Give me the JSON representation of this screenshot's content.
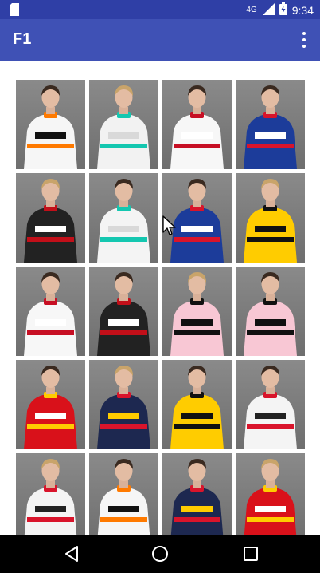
{
  "status_bar": {
    "network": "4G",
    "time": "9:34",
    "icons": [
      "sd-card-icon",
      "signal-icon",
      "battery-icon"
    ]
  },
  "app_bar": {
    "title": "F1",
    "menu_icon": "overflow-menu-icon"
  },
  "grid": {
    "tiles": [
      {
        "suit": "#f6f6f6",
        "accent": "#ff7a00",
        "stripe": "#111111",
        "name": "driver-photo-1"
      },
      {
        "suit": "#f2f2f2",
        "accent": "#14c7b0",
        "stripe": "#d9d9d9",
        "name": "driver-photo-2"
      },
      {
        "suit": "#f7f7f7",
        "accent": "#c70f24",
        "stripe": "#ffffff",
        "name": "driver-photo-3"
      },
      {
        "suit": "#1c3c9a",
        "accent": "#d9142b",
        "stripe": "#ffffff",
        "name": "driver-photo-4"
      },
      {
        "suit": "#222222",
        "accent": "#c20f19",
        "stripe": "#ffffff",
        "name": "driver-photo-5"
      },
      {
        "suit": "#f4f4f4",
        "accent": "#14c7b0",
        "stripe": "#d9d9d9",
        "name": "driver-photo-6"
      },
      {
        "suit": "#1c3c9a",
        "accent": "#d9142b",
        "stripe": "#ffffff",
        "name": "driver-photo-7"
      },
      {
        "suit": "#ffcc00",
        "accent": "#111111",
        "stripe": "#111111",
        "name": "driver-photo-8"
      },
      {
        "suit": "#f7f7f7",
        "accent": "#c70f24",
        "stripe": "#ffffff",
        "name": "driver-photo-9"
      },
      {
        "suit": "#222222",
        "accent": "#c20f19",
        "stripe": "#ffffff",
        "name": "driver-photo-10"
      },
      {
        "suit": "#f8c7d4",
        "accent": "#111111",
        "stripe": "#111111",
        "name": "driver-photo-11"
      },
      {
        "suit": "#f8c7d4",
        "accent": "#111111",
        "stripe": "#111111",
        "name": "driver-photo-12"
      },
      {
        "suit": "#d9111a",
        "accent": "#ffcc00",
        "stripe": "#ffffff",
        "name": "driver-photo-13"
      },
      {
        "suit": "#1d2850",
        "accent": "#d9142b",
        "stripe": "#ffcc00",
        "name": "driver-photo-14"
      },
      {
        "suit": "#ffcc00",
        "accent": "#111111",
        "stripe": "#111111",
        "name": "driver-photo-15"
      },
      {
        "suit": "#f4f4f4",
        "accent": "#d9142b",
        "stripe": "#222222",
        "name": "driver-photo-16"
      },
      {
        "suit": "#f4f4f4",
        "accent": "#d9142b",
        "stripe": "#222222",
        "name": "driver-photo-17"
      },
      {
        "suit": "#f6f6f6",
        "accent": "#ff7a00",
        "stripe": "#111111",
        "name": "driver-photo-18"
      },
      {
        "suit": "#1d2850",
        "accent": "#d9142b",
        "stripe": "#ffcc00",
        "name": "driver-photo-19"
      },
      {
        "suit": "#d9111a",
        "accent": "#ffcc00",
        "stripe": "#ffffff",
        "name": "driver-photo-20"
      }
    ]
  },
  "nav_bar": {
    "back_icon": "back-icon",
    "home_icon": "home-icon",
    "recents_icon": "recents-icon"
  }
}
